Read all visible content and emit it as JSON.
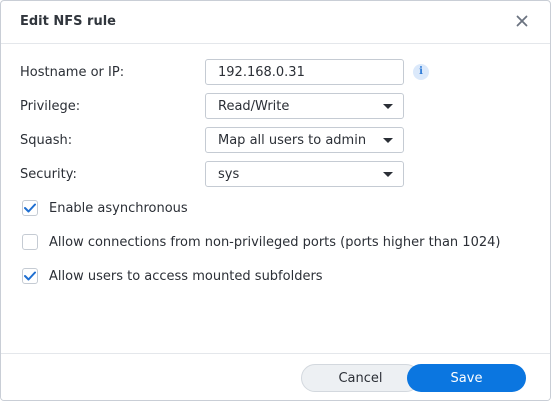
{
  "dialog": {
    "title": "Edit NFS rule",
    "close_icon": "close-icon"
  },
  "fields": {
    "hostname": {
      "label": "Hostname or IP:",
      "value": "192.168.0.31",
      "info_icon": "info-icon",
      "info_glyph": "i"
    },
    "privilege": {
      "label": "Privilege:",
      "value": "Read/Write"
    },
    "squash": {
      "label": "Squash:",
      "value": "Map all users to admin"
    },
    "security": {
      "label": "Security:",
      "value": "sys"
    }
  },
  "options": {
    "async": {
      "label": "Enable asynchronous",
      "checked": true
    },
    "nonpriv": {
      "label": "Allow connections from non-privileged ports (ports higher than 1024)",
      "checked": false
    },
    "subfolders": {
      "label": "Allow users to access mounted subfolders",
      "checked": true
    }
  },
  "footer": {
    "cancel_label": "Cancel",
    "save_label": "Save"
  },
  "colors": {
    "accent": "#0b76e0",
    "checkmark": "#1f6fd1",
    "info_bg": "#dbe9fb"
  }
}
